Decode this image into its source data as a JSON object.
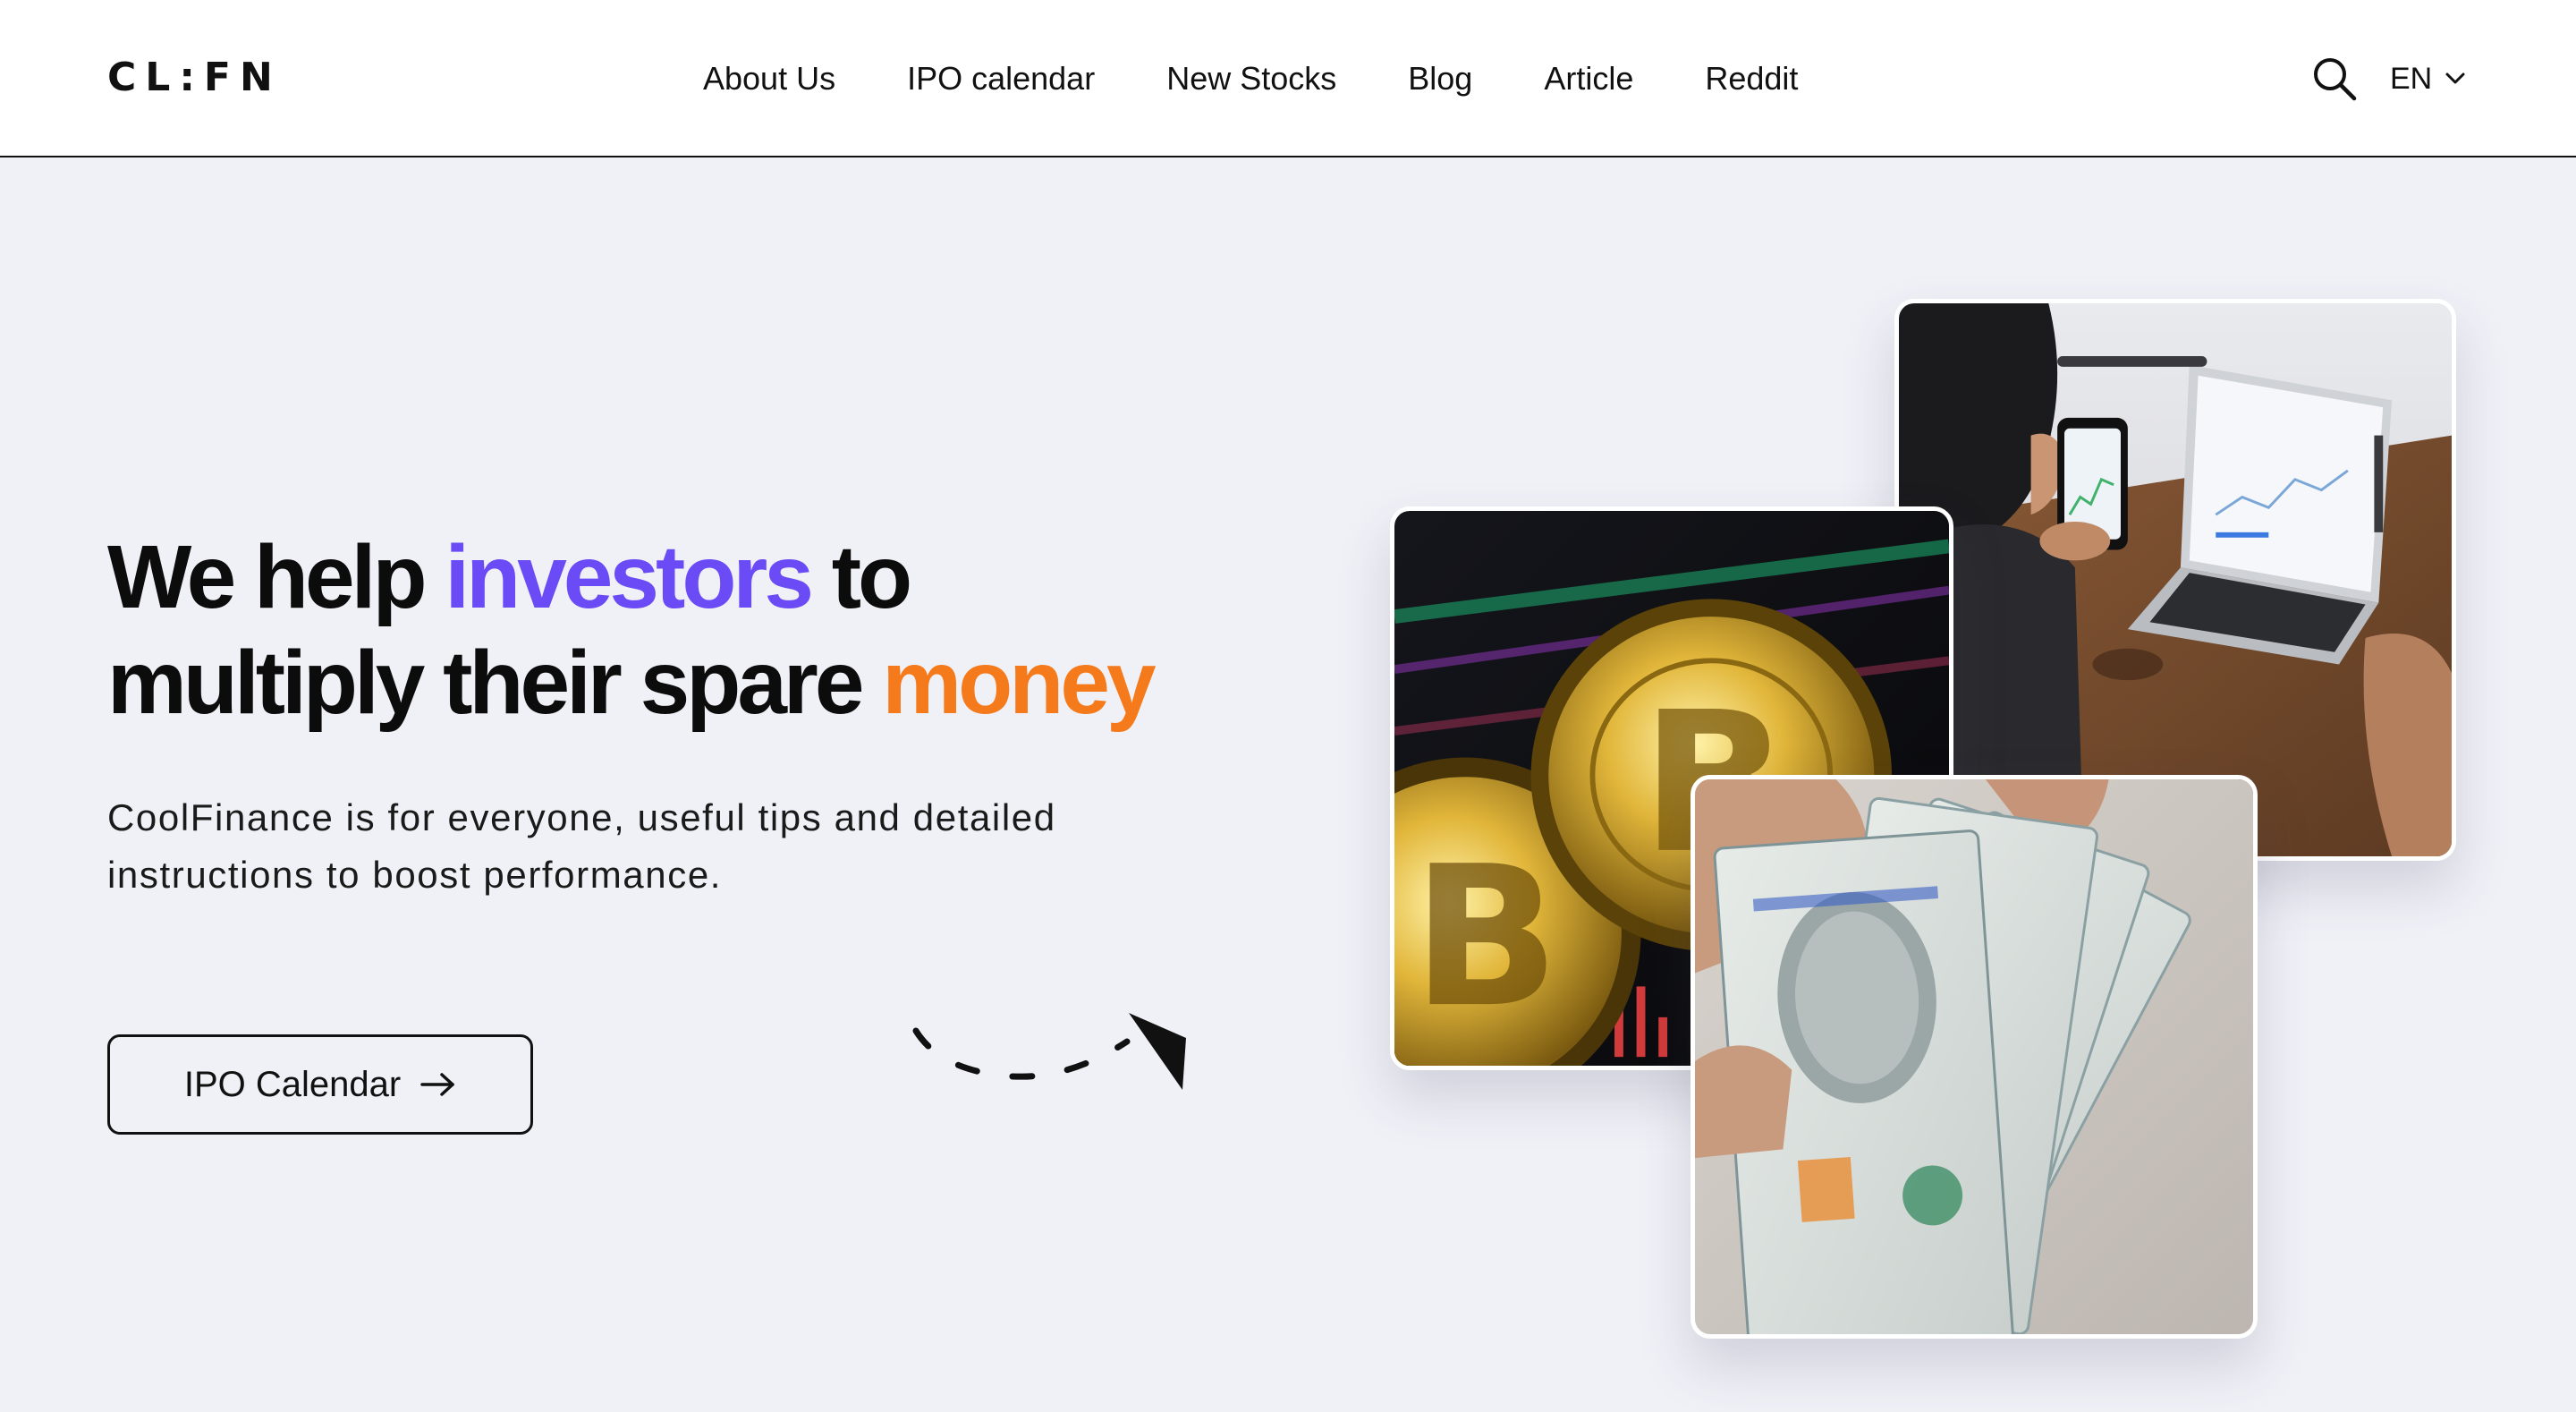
{
  "header": {
    "logo": "CL:FN",
    "nav": [
      {
        "label": "About Us"
      },
      {
        "label": "IPO calendar"
      },
      {
        "label": "New Stocks"
      },
      {
        "label": "Blog"
      },
      {
        "label": "Article"
      },
      {
        "label": "Reddit"
      }
    ],
    "search_icon": "search-icon",
    "language": "EN"
  },
  "hero": {
    "headline": {
      "part1": "We help ",
      "highlight1": "investors",
      "part2": " to",
      "line2_part1": "multiply their spare ",
      "highlight2": "money"
    },
    "subtitle": "CoolFinance is for everyone, useful tips and detailed instructions to boost performance.",
    "cta_label": "IPO Calendar"
  },
  "colors": {
    "accent_purple": "#6b4bf5",
    "accent_orange": "#f57a1c",
    "background": "#f0f1f7"
  }
}
